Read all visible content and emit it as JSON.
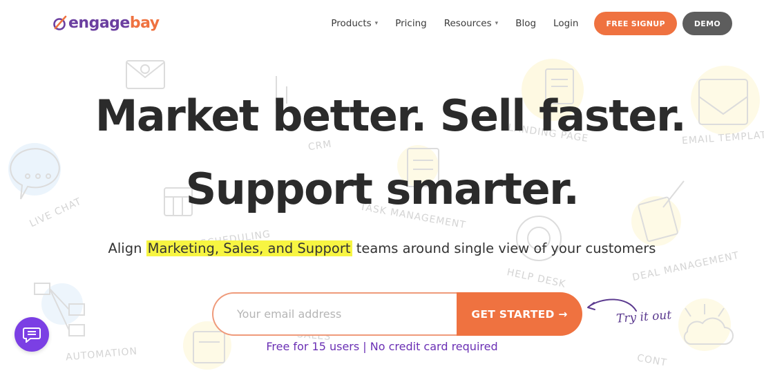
{
  "brand": {
    "logo_part1": "engage",
    "logo_part2": "bay",
    "purple": "#6b3fa0",
    "orange": "#ef7240"
  },
  "nav": {
    "products": "Products",
    "pricing": "Pricing",
    "resources": "Resources",
    "blog": "Blog",
    "login": "Login",
    "signup": "FREE SIGNUP",
    "demo": "DEMO"
  },
  "hero": {
    "headline_line1": "Market better. Sell faster.",
    "headline_line2": "Support smarter.",
    "subtitle_prefix": "Align ",
    "subtitle_highlight": "Marketing, Sales, and Support",
    "subtitle_suffix": " teams around single view of your customers",
    "email_placeholder": "Your email address",
    "cta": "GET STARTED →",
    "try_label": "Try it out",
    "note": "Free for 15 users | No credit card required"
  },
  "background_labels": {
    "crm": "CRM",
    "landing_page": "LANDING PAGE",
    "email_templates": "EMAIL TEMPLAT",
    "live_chat": "LIVE CHAT",
    "scheduling": "SCHEDULING",
    "task_management": "TASK MANAGEMENT",
    "help_desk": "HELP DESK",
    "deal_management": "DEAL MANAGEMENT",
    "automation": "AUTOMATION",
    "sales": "SALES",
    "contacts": "CONT"
  },
  "widgets": {
    "chat_icon": "chat-icon"
  }
}
